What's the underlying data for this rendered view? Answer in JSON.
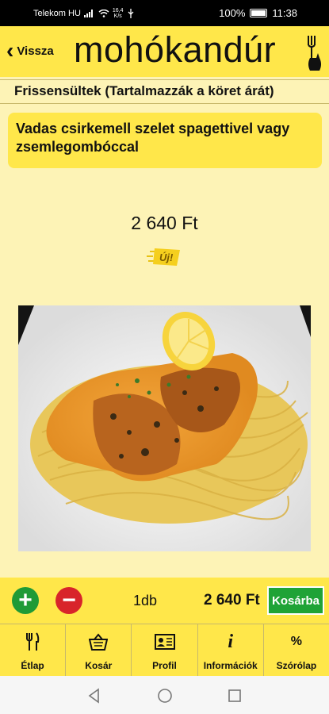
{
  "status_bar": {
    "carrier": "Telekom HU",
    "speed_value": "16,4",
    "speed_unit": "K/s",
    "battery": "100%",
    "time": "11:38"
  },
  "header": {
    "back_label": "Vissza",
    "brand": "mohókandúr"
  },
  "category": "Frissensültek (Tartalmazzák a köret árát)",
  "product": {
    "name": "Vadas csirkemell szelet spagettivel vagy zsemlegombóccal",
    "price": "2 640 Ft",
    "badge_text": "Új!"
  },
  "cart": {
    "quantity": "1db",
    "total": "2 640 Ft",
    "add_button": "Kosárba"
  },
  "tabs": [
    {
      "label": "Étlap",
      "icon": "cutlery-icon"
    },
    {
      "label": "Kosár",
      "icon": "basket-icon"
    },
    {
      "label": "Profil",
      "icon": "id-card-icon"
    },
    {
      "label": "Információk",
      "icon": "info-icon"
    },
    {
      "label": "Szórólap",
      "icon": "percent-icon"
    }
  ],
  "colors": {
    "accent": "#ffe74a",
    "background": "#fdf3b6",
    "add_green": "#1fa336",
    "remove_red": "#d8242a"
  }
}
